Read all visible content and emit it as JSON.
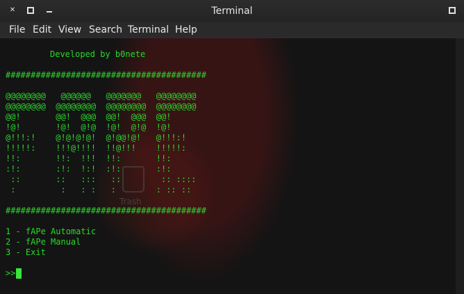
{
  "window": {
    "title": "Terminal"
  },
  "menubar": {
    "items": [
      "File",
      "Edit",
      "View",
      "Search",
      "Terminal",
      "Help"
    ]
  },
  "desktop": {
    "trash_label": "Trash"
  },
  "terminal": {
    "banner": "Developed by b0nete",
    "separator": "########################################",
    "art": [
      "@@@@@@@@   @@@@@@   @@@@@@@   @@@@@@@@",
      "@@@@@@@@  @@@@@@@@  @@@@@@@@  @@@@@@@@",
      "@@!       @@!  @@@  @@!  @@@  @@!",
      "!@!       !@!  @!@  !@!  @!@  !@!",
      "@!!!:!    @!@!@!@!  @!@@!@!   @!!!:!",
      "!!!!!:    !!!@!!!!  !!@!!!    !!!!!:",
      "!!:       !!:  !!!  !!:       !!:",
      ":!:       :!:  !:!  :!:       :!:",
      " ::       ::   :::   ::        :: ::::",
      " :         :   : :   :        : :: ::"
    ],
    "options": [
      "1 - fAPe Automatic",
      "2 - fAPe Manual",
      "3 - Exit"
    ],
    "prompt": ">>"
  },
  "colors": {
    "terminal_text": "#2bd72b",
    "terminal_bg": "#141414",
    "titlebar_bg": "#2c2c2c"
  }
}
